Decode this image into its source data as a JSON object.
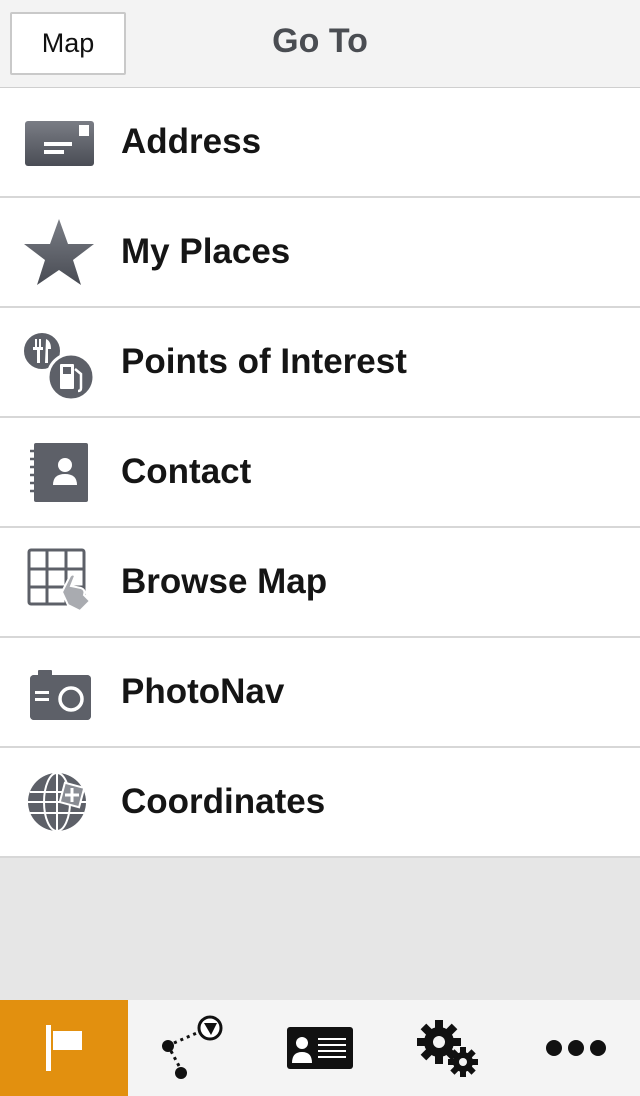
{
  "header": {
    "map_button": "Map",
    "title": "Go To"
  },
  "menu": [
    {
      "label": "Address",
      "icon": "address-card-icon"
    },
    {
      "label": "My Places",
      "icon": "star-icon"
    },
    {
      "label": "Points of Interest",
      "icon": "poi-fuel-food-icon"
    },
    {
      "label": "Contact",
      "icon": "contact-book-icon"
    },
    {
      "label": "Browse Map",
      "icon": "browse-map-icon"
    },
    {
      "label": "PhotoNav",
      "icon": "camera-icon"
    },
    {
      "label": "Coordinates",
      "icon": "globe-coordinates-icon"
    }
  ],
  "tabbar": [
    {
      "icon": "flag-icon",
      "active": true
    },
    {
      "icon": "route-icon",
      "active": false
    },
    {
      "icon": "contact-card-icon",
      "active": false
    },
    {
      "icon": "settings-gears-icon",
      "active": false
    },
    {
      "icon": "more-dots-icon",
      "active": false
    }
  ],
  "colors": {
    "accent": "#e2900f",
    "icon_gray": "#5d6068"
  }
}
